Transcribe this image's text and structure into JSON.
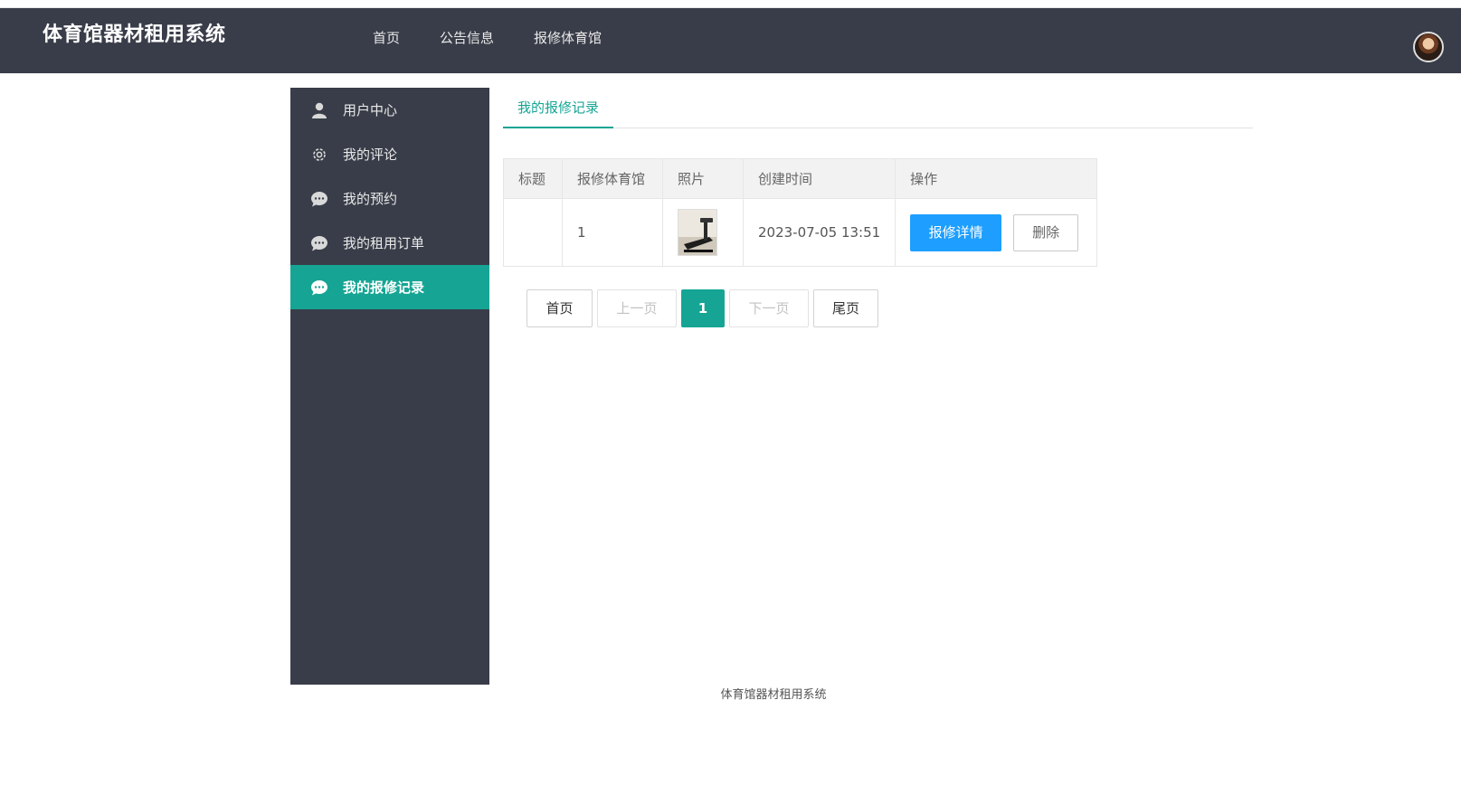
{
  "header": {
    "site_title": "体育馆器材租用系统",
    "nav": [
      {
        "label": "首页"
      },
      {
        "label": "公告信息"
      },
      {
        "label": "报修体育馆"
      }
    ]
  },
  "sidebar": {
    "items": [
      {
        "label": "用户中心",
        "icon": "user-icon"
      },
      {
        "label": "我的评论",
        "icon": "gear-icon"
      },
      {
        "label": "我的预约",
        "icon": "chat-bubble-icon"
      },
      {
        "label": "我的租用订单",
        "icon": "chat-bubble-icon"
      },
      {
        "label": "我的报修记录",
        "icon": "chat-bubble-icon",
        "active": true
      }
    ]
  },
  "tab": {
    "label": "我的报修记录"
  },
  "table": {
    "headers": [
      "标题",
      "报修体育馆",
      "照片",
      "创建时间",
      "操作"
    ],
    "rows": [
      {
        "title": "",
        "gym": "1",
        "photo": "treadmill-photo",
        "created": "2023-07-05 13:51",
        "detail_label": "报修详情",
        "delete_label": "删除"
      }
    ]
  },
  "pagination": {
    "first": "首页",
    "prev": "上一页",
    "current": "1",
    "next": "下一页",
    "last": "尾页"
  },
  "footer": {
    "text": "体育馆器材租用系统"
  },
  "colors": {
    "header_bg": "#393d49",
    "accent": "#16a594",
    "primary_button": "#1e9fff"
  }
}
